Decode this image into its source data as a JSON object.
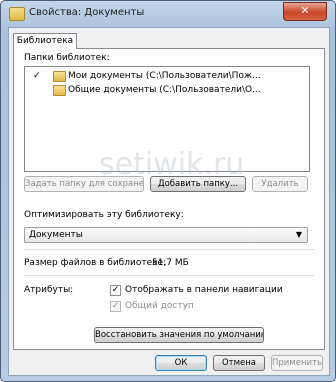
{
  "window": {
    "title": "Свойства: Документы",
    "close_glyph": "✕"
  },
  "tab": {
    "label": "Библиотека"
  },
  "folders_section": {
    "label": "Папки библиотек:",
    "items": [
      {
        "checked_glyph": "✓",
        "text": "Мои документы (C:\\Пользователи\\Пож..."
      },
      {
        "checked_glyph": "",
        "text": "Общие документы (C:\\Пользователи\\О..."
      }
    ],
    "buttons": {
      "set_save_location": "Задать папку для сохранения",
      "add_folder": "Добавить папку...",
      "remove": "Удалить"
    }
  },
  "optimize": {
    "label": "Оптимизировать эту библиотеку:",
    "selected": "Документы",
    "arrow": "▼"
  },
  "size": {
    "label": "Размер файлов в библиотеке:",
    "value": "51,7 МБ"
  },
  "attributes": {
    "label": "Атрибуты:",
    "show_in_nav": {
      "label": "Отображать в панели навигации",
      "checked": true,
      "glyph": "✓"
    },
    "shared": {
      "label": "Общий доступ",
      "checked": true,
      "glyph": "✓"
    }
  },
  "restore_defaults": "Восстановить значения по умолчанию",
  "dialog_buttons": {
    "ok": "ОК",
    "cancel": "Отмена",
    "apply": "Применить"
  },
  "watermark": "setiwik.ru"
}
